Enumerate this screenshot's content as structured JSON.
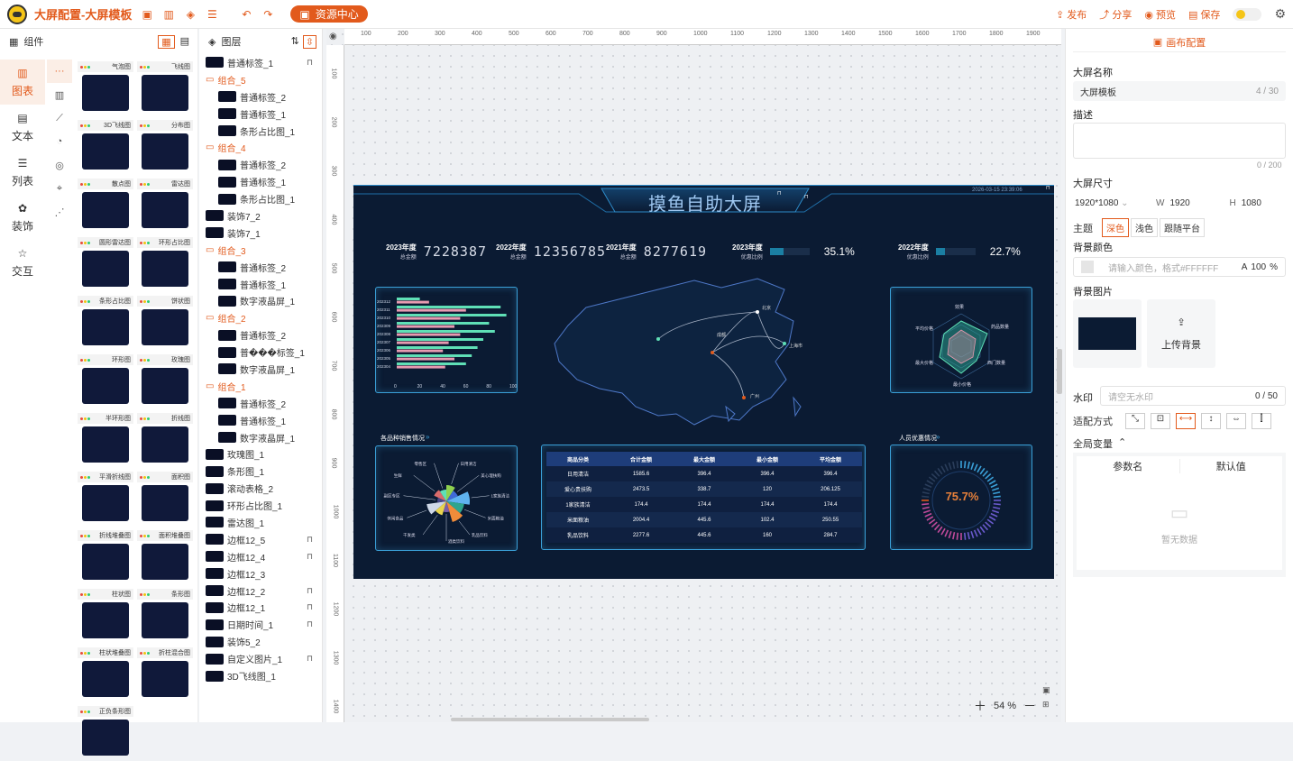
{
  "topbar": {
    "title": "大屏配置-大屏模板",
    "resource_center": "资源中心",
    "publish": "发布",
    "share": "分享",
    "preview": "预览",
    "save": "保存"
  },
  "components": {
    "panel_title": "组件",
    "tabs": [
      {
        "label": "图表",
        "icon": "chart-icon"
      },
      {
        "label": "文本",
        "icon": "text-icon"
      },
      {
        "label": "列表",
        "icon": "list-icon"
      },
      {
        "label": "装饰",
        "icon": "decoration-icon"
      },
      {
        "label": "交互",
        "icon": "star-icon"
      }
    ],
    "items": [
      "气泡图",
      "飞线图",
      "3D飞线图",
      "分布图",
      "散点图",
      "雷达图",
      "圆形雷达图",
      "环形占比图",
      "条形占比图",
      "饼状图",
      "环形图",
      "玫瑰图",
      "半环形图",
      "折线图",
      "平滑折线图",
      "面积图",
      "折线堆叠图",
      "面积堆叠图",
      "柱状图",
      "条形图",
      "柱状堆叠图",
      "折柱混合图",
      "正负条形图"
    ]
  },
  "layers": {
    "panel_title": "图层",
    "rows": [
      {
        "type": "item",
        "label": "普通标签_1",
        "indent": 0,
        "lock": true
      },
      {
        "type": "group",
        "label": "组合_5"
      },
      {
        "type": "item",
        "label": "普通标签_2",
        "indent": 1
      },
      {
        "type": "item",
        "label": "普通标签_1",
        "indent": 1
      },
      {
        "type": "item",
        "label": "条形占比图_1",
        "indent": 1
      },
      {
        "type": "group",
        "label": "组合_4"
      },
      {
        "type": "item",
        "label": "普通标签_2",
        "indent": 1
      },
      {
        "type": "item",
        "label": "普通标签_1",
        "indent": 1
      },
      {
        "type": "item",
        "label": "条形占比图_1",
        "indent": 1
      },
      {
        "type": "item",
        "label": "装饰7_2",
        "indent": 0
      },
      {
        "type": "item",
        "label": "装饰7_1",
        "indent": 0
      },
      {
        "type": "group",
        "label": "组合_3"
      },
      {
        "type": "item",
        "label": "普通标签_2",
        "indent": 1
      },
      {
        "type": "item",
        "label": "普通标签_1",
        "indent": 1
      },
      {
        "type": "item",
        "label": "数字液晶屏_1",
        "indent": 1
      },
      {
        "type": "group",
        "label": "组合_2"
      },
      {
        "type": "item",
        "label": "普通标签_2",
        "indent": 1
      },
      {
        "type": "item",
        "label": "普���标签_1",
        "indent": 1
      },
      {
        "type": "item",
        "label": "数字液晶屏_1",
        "indent": 1
      },
      {
        "type": "group",
        "label": "组合_1"
      },
      {
        "type": "item",
        "label": "普通标签_2",
        "indent": 1
      },
      {
        "type": "item",
        "label": "普通标签_1",
        "indent": 1
      },
      {
        "type": "item",
        "label": "数字液晶屏_1",
        "indent": 1
      },
      {
        "type": "item",
        "label": "玫瑰图_1",
        "indent": 0
      },
      {
        "type": "item",
        "label": "条形图_1",
        "indent": 0
      },
      {
        "type": "item",
        "label": "滚动表格_2",
        "indent": 0
      },
      {
        "type": "item",
        "label": "环形占比图_1",
        "indent": 0
      },
      {
        "type": "item",
        "label": "雷达图_1",
        "indent": 0
      },
      {
        "type": "item",
        "label": "边框12_5",
        "indent": 0,
        "lock": true
      },
      {
        "type": "item",
        "label": "边框12_4",
        "indent": 0,
        "lock": true
      },
      {
        "type": "item",
        "label": "边框12_3",
        "indent": 0
      },
      {
        "type": "item",
        "label": "边框12_2",
        "indent": 0,
        "lock": true
      },
      {
        "type": "item",
        "label": "边框12_1",
        "indent": 0,
        "lock": true
      },
      {
        "type": "item",
        "label": "日期时间_1",
        "indent": 0,
        "lock": true
      },
      {
        "type": "item",
        "label": "装饰5_2",
        "indent": 0
      },
      {
        "type": "item",
        "label": "自定义图片_1",
        "indent": 0,
        "lock": true
      },
      {
        "type": "item",
        "label": "3D飞线图_1",
        "indent": 0
      }
    ]
  },
  "ruler": {
    "h": [
      "100",
      "200",
      "300",
      "400",
      "500",
      "600",
      "700",
      "800",
      "900",
      "1000",
      "1100",
      "1200",
      "1300",
      "1400",
      "1500",
      "1600",
      "1700",
      "1800",
      "1900"
    ],
    "v": [
      "100",
      "200",
      "300",
      "400",
      "500",
      "600",
      "700",
      "800",
      "900",
      "1000",
      "1100",
      "1200",
      "1300",
      "1400"
    ]
  },
  "screen": {
    "title": "摸鱼自助大屏",
    "datetime": "2026-03-15 23:39:06",
    "kpis": [
      {
        "year": "2023年度",
        "sub": "总金额",
        "value": "7228387"
      },
      {
        "year": "2022年度",
        "sub": "总金额",
        "value": "12356785"
      },
      {
        "year": "2021年度",
        "sub": "总金额",
        "value": "8277619"
      }
    ],
    "ratios": [
      {
        "year": "2023年度",
        "sub": "优惠比例",
        "value": "35.1%",
        "fraction": 0.351
      },
      {
        "year": "2022年度",
        "sub": "优惠比例",
        "value": "22.7%",
        "fraction": 0.227
      }
    ],
    "rose_title": "各品种销售情况",
    "discount_title": "人员优惠情况",
    "gauge_value": "75.7%",
    "gauge_fraction": 0.757,
    "table": {
      "headers": [
        "商品分类",
        "合计金额",
        "最大金额",
        "最小金额",
        "平均金额"
      ],
      "rows": [
        [
          "日用清洁",
          "1585.6",
          "396.4",
          "396.4",
          "396.4"
        ],
        [
          "爱心贵扶购",
          "2473.5",
          "338.7",
          "120",
          "206.125"
        ],
        [
          "1家族清洁",
          "174.4",
          "174.4",
          "174.4",
          "174.4"
        ],
        [
          "米面粮油",
          "2004.4",
          "445.6",
          "102.4",
          "250.55"
        ],
        [
          "乳品饮料",
          "2277.6",
          "445.6",
          "160",
          "284.7"
        ]
      ]
    },
    "radar_labels": [
      "效果",
      "药品数量",
      "西门数量",
      "最小价格",
      "最大价格",
      "平均价格"
    ],
    "rose_labels": [
      "日用清洁",
      "美心理扶购",
      "1家族清洁",
      "米面粮油",
      "乳品饮料",
      "酒类饮料",
      "干发类",
      "休闲食品",
      "副区专区",
      "生鲜",
      "零售区"
    ],
    "map_labels": [
      "成都",
      "北京",
      "上海市",
      "广州"
    ]
  },
  "chart_data": [
    {
      "type": "bar",
      "categories": [
        "202312",
        "202311",
        "202310",
        "202309",
        "202308",
        "202307",
        "202306",
        "202305",
        "202304"
      ],
      "series": [
        {
          "values": [
            20,
            90,
            95,
            80,
            85,
            75,
            70,
            65,
            60
          ]
        },
        {
          "values": [
            28,
            60,
            55,
            50,
            55,
            45,
            40,
            50,
            42
          ]
        }
      ],
      "ylim": [
        0,
        100
      ],
      "ticks": [
        "0",
        "20",
        "40",
        "60",
        "80",
        "100"
      ]
    }
  ],
  "zoom": {
    "value": "54 %"
  },
  "right": {
    "tab": "画布配置",
    "name_label": "大屏名称",
    "name_value": "大屏模板",
    "name_count": "4 / 30",
    "desc_label": "描述",
    "desc_count": "0 / 200",
    "size_label": "大屏尺寸",
    "size_value": "1920*1080",
    "w_label": "W",
    "w_value": "1920",
    "h_label": "H",
    "h_value": "1080",
    "theme_label": "主题",
    "themes": [
      "深色",
      "浅色",
      "跟随平台"
    ],
    "bg_color_label": "背景颜色",
    "bg_color_placeholder": "请输入颜色，格式#FFFFFF",
    "alpha_label": "A",
    "alpha_value": "100",
    "alpha_unit": "%",
    "bg_img_label": "背景图片",
    "upload": "上传背景",
    "watermark_label": "水印",
    "watermark_placeholder": "请空无水印",
    "watermark_count": "0 / 50",
    "adapt_label": "适配方式",
    "global_label": "全局变量",
    "param_col": "参数名",
    "default_col": "默认值",
    "empty": "暂无数据"
  },
  "colors": {
    "accent": "#e25a1c",
    "screen_bg": "#0b1b33",
    "bar_a": "#5fe0b6",
    "bar_b": "#e79ab0"
  }
}
